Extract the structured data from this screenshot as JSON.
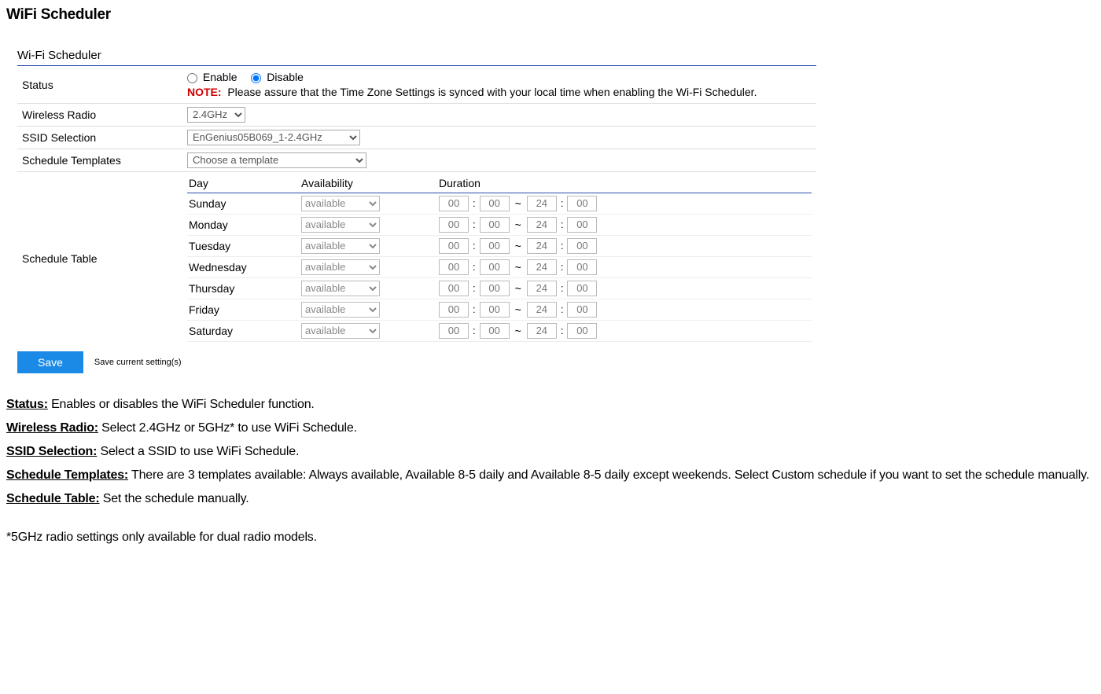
{
  "page_title": "WiFi Scheduler",
  "panel_title": "Wi-Fi Scheduler",
  "rows": {
    "status": {
      "label": "Status",
      "enable": "Enable",
      "disable": "Disable",
      "note_label": "NOTE:",
      "note_text": "Please assure that the Time Zone Settings is synced with your local time when enabling the Wi-Fi Scheduler."
    },
    "radio": {
      "label": "Wireless Radio",
      "value": "2.4GHz"
    },
    "ssid": {
      "label": "SSID Selection",
      "value": "EnGenius05B069_1-2.4GHz"
    },
    "template": {
      "label": "Schedule Templates",
      "value": "Choose a template"
    },
    "schedule": {
      "label": "Schedule Table",
      "col_day": "Day",
      "col_avail": "Availability",
      "col_dur": "Duration"
    }
  },
  "schedule_rows": [
    {
      "day": "Sunday",
      "avail": "available",
      "h1": "00",
      "m1": "00",
      "h2": "24",
      "m2": "00"
    },
    {
      "day": "Monday",
      "avail": "available",
      "h1": "00",
      "m1": "00",
      "h2": "24",
      "m2": "00"
    },
    {
      "day": "Tuesday",
      "avail": "available",
      "h1": "00",
      "m1": "00",
      "h2": "24",
      "m2": "00"
    },
    {
      "day": "Wednesday",
      "avail": "available",
      "h1": "00",
      "m1": "00",
      "h2": "24",
      "m2": "00"
    },
    {
      "day": "Thursday",
      "avail": "available",
      "h1": "00",
      "m1": "00",
      "h2": "24",
      "m2": "00"
    },
    {
      "day": "Friday",
      "avail": "available",
      "h1": "00",
      "m1": "00",
      "h2": "24",
      "m2": "00"
    },
    {
      "day": "Saturday",
      "avail": "available",
      "h1": "00",
      "m1": "00",
      "h2": "24",
      "m2": "00"
    }
  ],
  "save": {
    "button": "Save",
    "hint": "Save current setting(s)"
  },
  "descriptions": [
    {
      "term": "Status:",
      "text": " Enables or disables the WiFi Scheduler function."
    },
    {
      "term": "Wireless Radio:",
      "text": " Select 2.4GHz or 5GHz* to use WiFi Schedule."
    },
    {
      "term": "SSID Selection:",
      "text": " Select a SSID to use WiFi Schedule."
    },
    {
      "term": "Schedule Templates:",
      "text": " There are 3 templates available: Always available, Available 8-5 daily and Available 8-5 daily except weekends. Select Custom schedule if you want to set the schedule manually."
    },
    {
      "term": "Schedule Table:",
      "text": " Set the schedule manually."
    }
  ],
  "footnote": "*5GHz radio settings only available for dual radio models."
}
